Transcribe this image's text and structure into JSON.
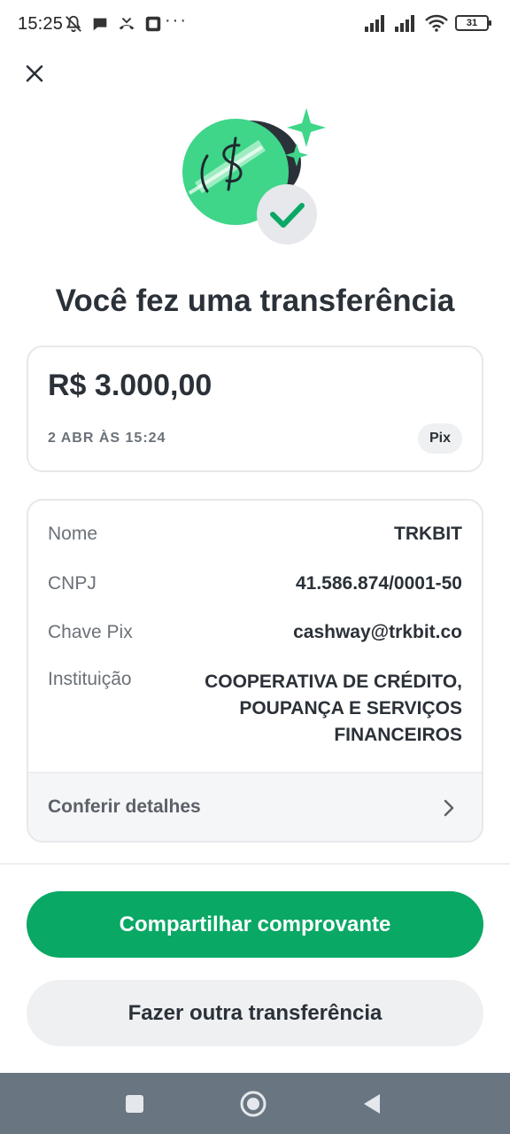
{
  "status_bar": {
    "time": "15:25",
    "battery": "31",
    "more": "···",
    "icons": [
      "notifications-off-icon",
      "chat-bubble-icon",
      "missed-call-icon",
      "app-notification-icon",
      "signal-icon",
      "signal-icon",
      "wifi-icon",
      "battery-icon"
    ]
  },
  "close_icon": "close-icon",
  "title": "Você fez uma transferência",
  "amount": {
    "value": "R$ 3.000,00",
    "date": "2 ABR ÀS 15:24",
    "method": "Pix"
  },
  "details": {
    "rows": [
      {
        "label": "Nome",
        "value": "TRKBIT"
      },
      {
        "label": "CNPJ",
        "value": "41.586.874/0001-50"
      },
      {
        "label": "Chave Pix",
        "value": "cashway@trkbit.co"
      },
      {
        "label": "Instituição",
        "value": "COOPERATIVA DE CRÉDITO, POUPANÇA E SERVIÇOS FINANCEIROS"
      }
    ],
    "footer_label": "Conferir detalhes"
  },
  "buttons": {
    "share": "Compartilhar comprovante",
    "another": "Fazer outra transferência"
  },
  "colors": {
    "accent": "#0aa865",
    "text": "#2b3138",
    "nav_bar": "#697580"
  }
}
